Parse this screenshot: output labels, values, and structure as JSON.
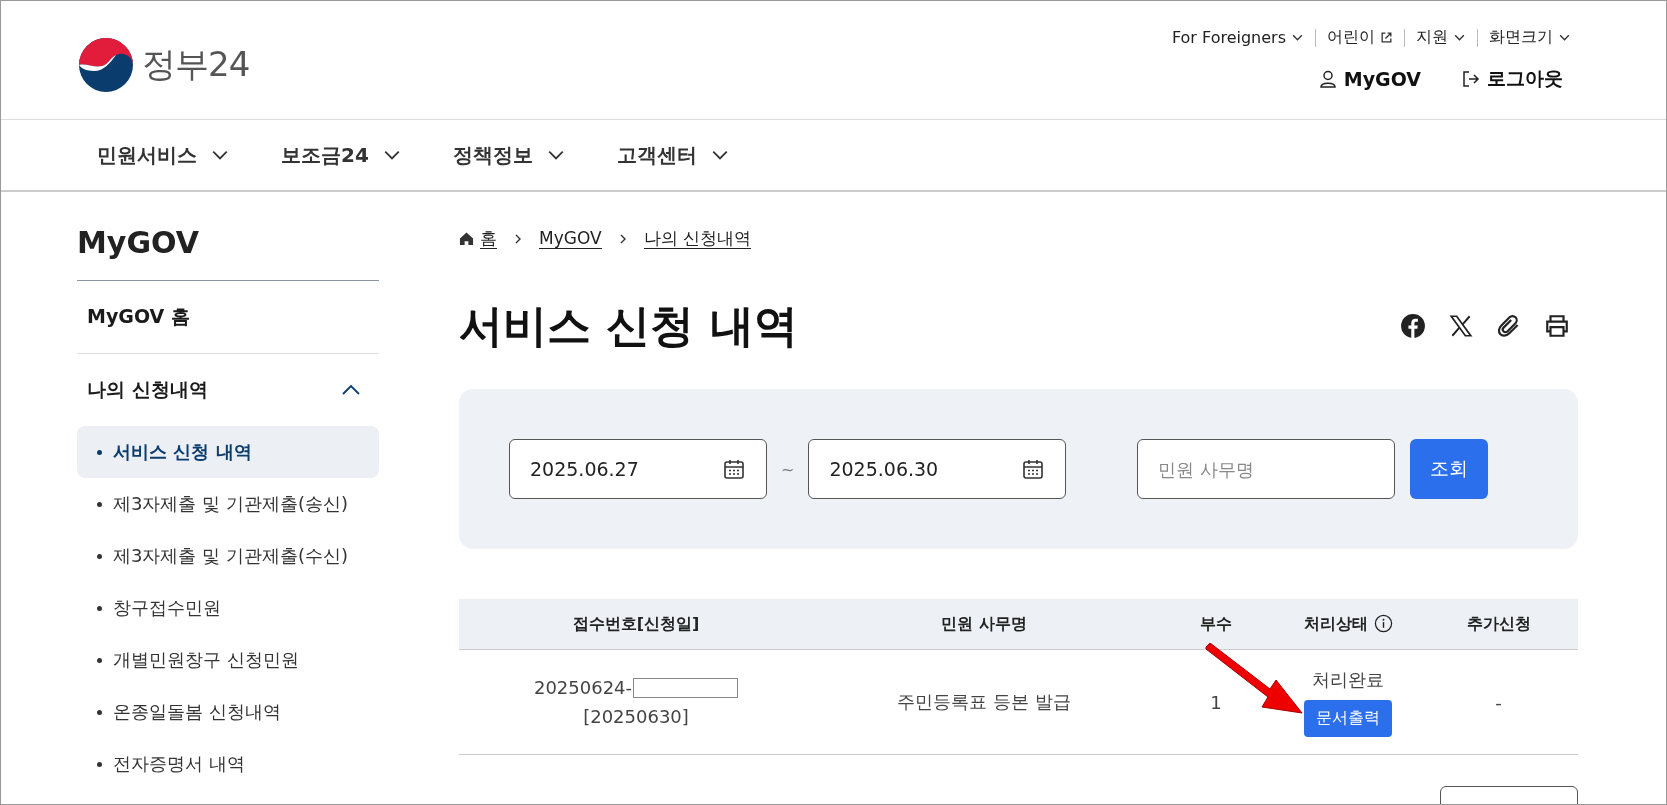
{
  "logo": {
    "text": "정부24"
  },
  "top_links": [
    "For Foreigners",
    "어린이",
    "지원",
    "화면크기"
  ],
  "user_links": [
    "MyGOV",
    "로그아웃"
  ],
  "nav": [
    "민원서비스",
    "보조금24",
    "정책정보",
    "고객센터"
  ],
  "sidebar": {
    "title": "MyGOV",
    "items": [
      {
        "label": "MyGOV 홈"
      },
      {
        "label": "나의 신청내역",
        "expanded": true,
        "children": [
          {
            "label": "서비스 신청 내역",
            "selected": true
          },
          {
            "label": "제3자제출 및 기관제출(송신)",
            "selected": false
          },
          {
            "label": "제3자제출 및 기관제출(수신)",
            "selected": false
          },
          {
            "label": "창구접수민원",
            "selected": false
          },
          {
            "label": "개별민원창구 신청민원",
            "selected": false
          },
          {
            "label": "온종일돌봄 신청내역",
            "selected": false
          },
          {
            "label": "전자증명서 내역",
            "selected": false
          }
        ]
      }
    ]
  },
  "breadcrumb": [
    "홈",
    "MyGOV",
    "나의 신청내역"
  ],
  "page_title": "서비스 신청 내역",
  "search": {
    "date_from": "2025.06.27",
    "separator": "~",
    "date_to": "2025.06.30",
    "placeholder": "민원 사무명",
    "button": "조회"
  },
  "table": {
    "columns": [
      "접수번호[신청일]",
      "민원 사무명",
      "부수",
      "처리상태",
      "추가신청"
    ],
    "rows": [
      {
        "receipt_no": "20250624-",
        "date": "[20250630]",
        "name": "주민등록표 등본 발급",
        "copies": "1",
        "status": "처리완료",
        "action": "문서출력",
        "extra": "-"
      }
    ]
  },
  "annotation": {
    "kind": "arrow"
  }
}
